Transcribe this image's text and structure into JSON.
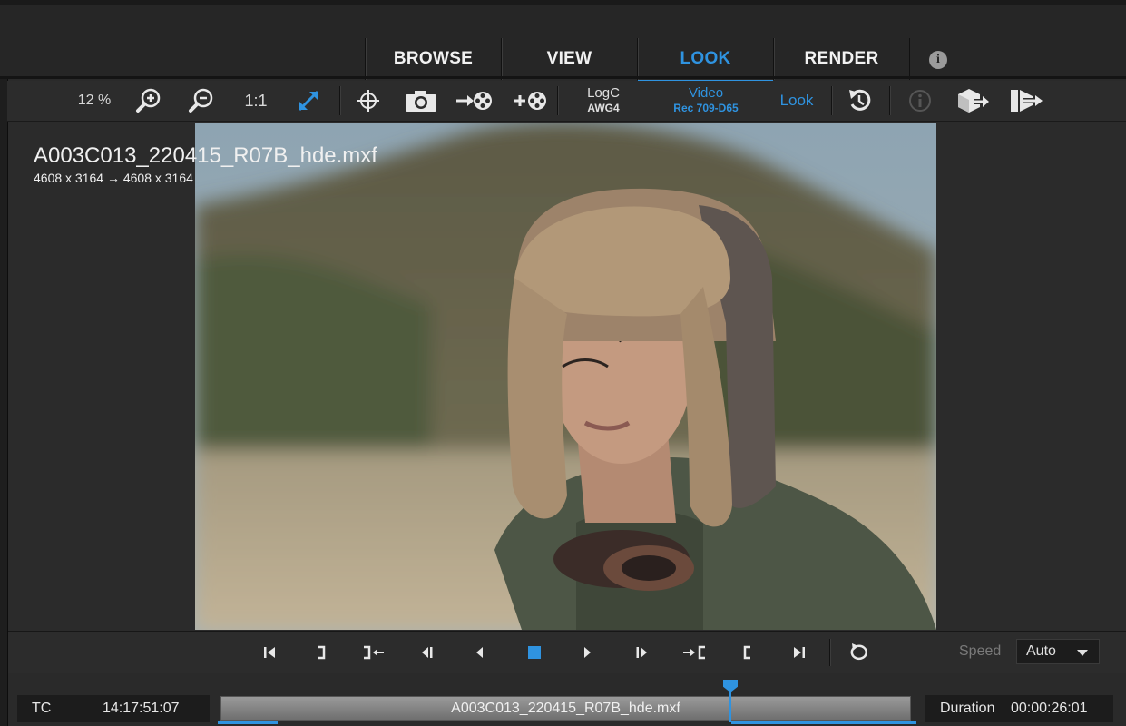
{
  "tabs": [
    {
      "label": "BROWSE",
      "active": false
    },
    {
      "label": "VIEW",
      "active": false
    },
    {
      "label": "LOOK",
      "active": true
    },
    {
      "label": "RENDER",
      "active": false
    }
  ],
  "toolbar": {
    "zoom": "12 %",
    "one_to_one": "1:1",
    "input_colorspace": {
      "line1": "LogC",
      "line2": "AWG4"
    },
    "output_colorspace": {
      "line1": "Video",
      "line2": "Rec 709-D65"
    },
    "look_label": "Look"
  },
  "viewer": {
    "filename": "A003C013_220415_R07B_hde.mxf",
    "dimensions": "4608 x 3164  → 4608 x 3164"
  },
  "transport": {
    "speed_label": "Speed",
    "speed_value": "Auto"
  },
  "timeline": {
    "tc_label": "TC",
    "tc_value": "14:17:51:07",
    "clip_name": "A003C013_220415_R07B_hde.mxf",
    "duration_label": "Duration",
    "duration_value": "00:00:26:01"
  },
  "colors": {
    "accent": "#2f93e0",
    "background": "#2a2a2a"
  }
}
